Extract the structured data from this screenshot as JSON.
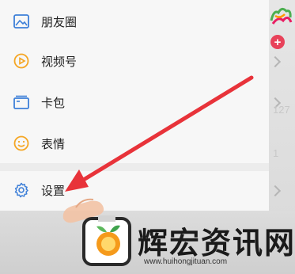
{
  "menu": {
    "items": [
      {
        "label": "朋友圈",
        "icon": "moments-icon"
      },
      {
        "label": "视频号",
        "icon": "channels-icon"
      },
      {
        "label": "卡包",
        "icon": "card-wallet-icon"
      },
      {
        "label": "表情",
        "icon": "sticker-smiley-icon"
      },
      {
        "label": "设置",
        "icon": "settings-gear-icon"
      }
    ]
  },
  "side": {
    "count_1": "127",
    "count_2": "1"
  },
  "watermark": {
    "title": "辉宏资讯网",
    "url": "www.huihongjituan.com"
  },
  "colors": {
    "icon_blue": "#3d7fd8",
    "icon_orange": "#f5a623",
    "arrow_red": "#e8333a",
    "badge_red": "#e8425a"
  }
}
